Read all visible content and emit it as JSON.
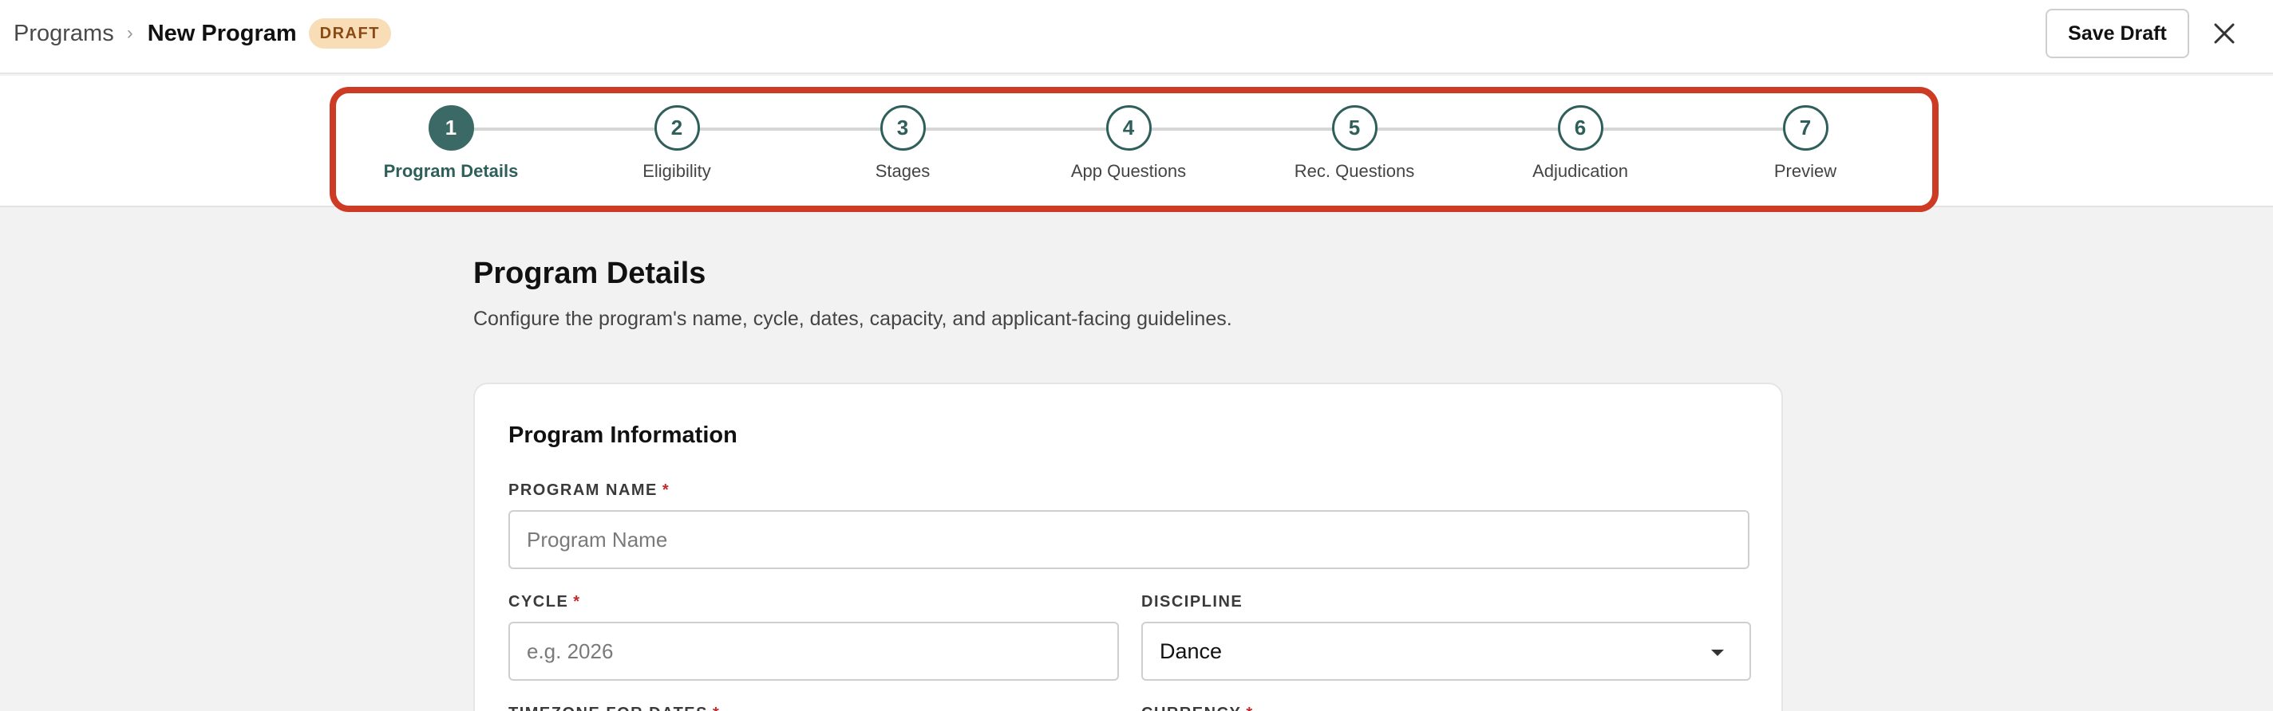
{
  "breadcrumb": {
    "parent": "Programs",
    "separator": "›",
    "current": "New Program",
    "badge": "DRAFT"
  },
  "actions": {
    "save_draft": "Save Draft",
    "close_icon": "close-icon"
  },
  "stepper": {
    "steps": [
      {
        "number": "1",
        "label": "Program Details",
        "active": true
      },
      {
        "number": "2",
        "label": "Eligibility",
        "active": false
      },
      {
        "number": "3",
        "label": "Stages",
        "active": false
      },
      {
        "number": "4",
        "label": "App Questions",
        "active": false
      },
      {
        "number": "5",
        "label": "Rec. Questions",
        "active": false
      },
      {
        "number": "6",
        "label": "Adjudication",
        "active": false
      },
      {
        "number": "7",
        "label": "Preview",
        "active": false
      }
    ]
  },
  "page": {
    "title": "Program Details",
    "subtitle": "Configure the program's name, cycle, dates, capacity, and applicant-facing guidelines."
  },
  "form": {
    "section_title": "Program Information",
    "required_marker": "*",
    "program_name": {
      "label": "PROGRAM NAME",
      "placeholder": "Program Name",
      "value": ""
    },
    "cycle": {
      "label": "CYCLE",
      "placeholder": "e.g. 2026",
      "value": ""
    },
    "discipline": {
      "label": "DISCIPLINE",
      "value": "Dance"
    },
    "timezone": {
      "label": "TIMEZONE FOR DATES"
    },
    "currency": {
      "label": "CURRENCY"
    }
  },
  "colors": {
    "accent": "#3b6a66",
    "highlight_frame": "#cd3b25",
    "draft_badge_bg": "#f8ddb7",
    "draft_badge_text": "#8a4a15",
    "required": "#c62828"
  }
}
